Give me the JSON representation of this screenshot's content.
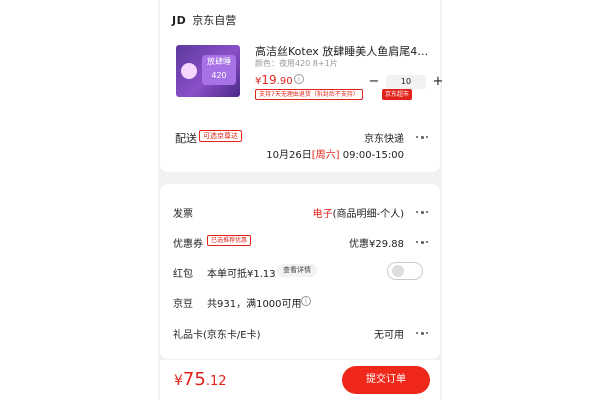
{
  "store": {
    "logo": "JD",
    "name": "京东自营"
  },
  "product": {
    "title": "高洁丝Kotex 放肆睡美人鱼肩尾420m...",
    "spec": "颜色：夜用420 8+1片",
    "pkg_text": "放肆睡 420",
    "price_symbol": "¥",
    "price_int": "19",
    "price_dec": ".90",
    "info": "i",
    "qty_minus": "−",
    "quantity": "10",
    "qty_plus": "+",
    "return_tag": "支持7天无理由退货（拆封后不支持）",
    "supermarket_tag": "京东超市"
  },
  "delivery": {
    "label": "配送",
    "tag": "可选京尊达",
    "method": "京东快递",
    "date": "10月26日",
    "weekday": "[周六]",
    "time": "09:00-15:00"
  },
  "invoice": {
    "label": "发票",
    "type": "电子",
    "detail": "(商品明细-个人)"
  },
  "coupon": {
    "label": "优惠券",
    "tag": "已选推荐优惠",
    "value": "优惠¥29.88"
  },
  "redpacket": {
    "label": "红包",
    "desc": "本单可抵¥1.13",
    "detail": "查看详情",
    "enabled": false
  },
  "jingdou": {
    "label": "京豆",
    "desc": "共931，满1000可用",
    "info": "i"
  },
  "giftcard": {
    "label": "礼品卡(京东卡/E卡)",
    "value": "无可用"
  },
  "footer": {
    "currency": "¥",
    "total_int": "75",
    "total_dec": ".12",
    "submit_label": "提交订单"
  },
  "colors": {
    "accent": "#e2231a",
    "button": "#f0281c",
    "background": "#f2f2f2"
  }
}
